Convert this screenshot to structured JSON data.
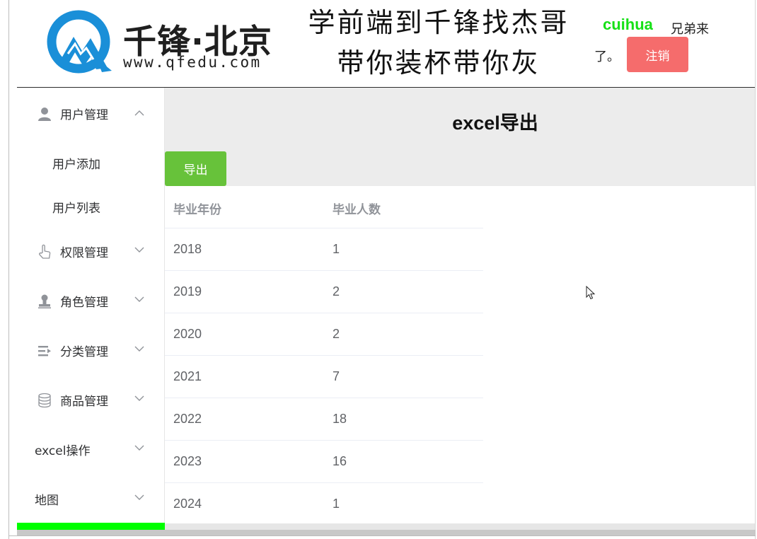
{
  "header": {
    "logo_name": "千锋·北京",
    "logo_url": "www.qfedu.com",
    "slogan_line1": "学前端到千锋找杰哥",
    "slogan_line2": "带你装杯带你灰",
    "username": "cuihua",
    "greeting_part1": "兄弟来",
    "greeting_part2": "了。",
    "logout_label": "注销"
  },
  "sidebar": {
    "user_mgmt": {
      "label": "用户管理",
      "icon": "user-icon",
      "expanded": true
    },
    "sub_items": [
      {
        "label": "用户添加"
      },
      {
        "label": "用户列表"
      }
    ],
    "items": [
      {
        "label": "权限管理",
        "icon": "hand-pointer-icon"
      },
      {
        "label": "角色管理",
        "icon": "stamp-icon"
      },
      {
        "label": "分类管理",
        "icon": "list-icon"
      },
      {
        "label": "商品管理",
        "icon": "database-icon"
      },
      {
        "label": "excel操作",
        "icon": ""
      },
      {
        "label": "地图",
        "icon": ""
      }
    ],
    "active_bar_color": "#00ff00"
  },
  "main": {
    "title": "excel导出",
    "export_label": "导出",
    "table": {
      "headers": [
        "毕业年份",
        "毕业人数"
      ],
      "rows": [
        [
          "2018",
          "1"
        ],
        [
          "2019",
          "2"
        ],
        [
          "2020",
          "2"
        ],
        [
          "2021",
          "7"
        ],
        [
          "2022",
          "18"
        ],
        [
          "2023",
          "16"
        ],
        [
          "2024",
          "1"
        ]
      ]
    }
  },
  "colors": {
    "logout": "#f56c6c",
    "export": "#67c23a",
    "username": "#16e016",
    "main_bg": "#ececec"
  }
}
